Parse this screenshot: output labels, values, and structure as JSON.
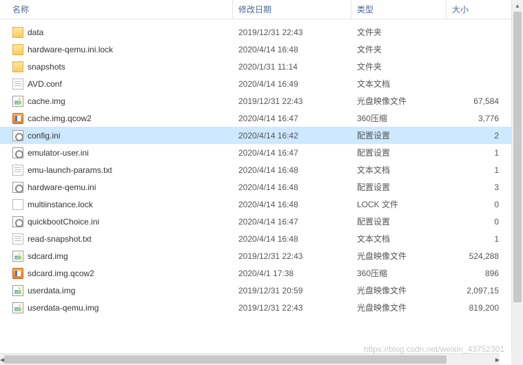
{
  "columns": {
    "name": "名称",
    "date": "修改日期",
    "type": "类型",
    "size": "大小"
  },
  "files": [
    {
      "icon": "folder",
      "name": "data",
      "date": "2019/12/31 22:43",
      "type": "文件夹",
      "size": "",
      "selected": false
    },
    {
      "icon": "folder",
      "name": "hardware-qemu.ini.lock",
      "date": "2020/4/14 16:48",
      "type": "文件夹",
      "size": "",
      "selected": false
    },
    {
      "icon": "folder",
      "name": "snapshots",
      "date": "2020/1/31 11:14",
      "type": "文件夹",
      "size": "",
      "selected": false
    },
    {
      "icon": "txt",
      "name": "AVD.conf",
      "date": "2020/4/14 16:49",
      "type": "文本文档",
      "size": "",
      "selected": false
    },
    {
      "icon": "img",
      "name": "cache.img",
      "date": "2019/12/31 22:43",
      "type": "光盘映像文件",
      "size": "67,584",
      "selected": false
    },
    {
      "icon": "qcow",
      "name": "cache.img.qcow2",
      "date": "2020/4/14 16:47",
      "type": "360压缩",
      "size": "3,776",
      "selected": false
    },
    {
      "icon": "ini",
      "name": "config.ini",
      "date": "2020/4/14 16:42",
      "type": "配置设置",
      "size": "2",
      "selected": true
    },
    {
      "icon": "ini",
      "name": "emulator-user.ini",
      "date": "2020/4/14 16:47",
      "type": "配置设置",
      "size": "1",
      "selected": false
    },
    {
      "icon": "txt",
      "name": "emu-launch-params.txt",
      "date": "2020/4/14 16:48",
      "type": "文本文档",
      "size": "1",
      "selected": false
    },
    {
      "icon": "ini",
      "name": "hardware-qemu.ini",
      "date": "2020/4/14 16:48",
      "type": "配置设置",
      "size": "3",
      "selected": false
    },
    {
      "icon": "lock",
      "name": "multiinstance.lock",
      "date": "2020/4/14 16:48",
      "type": "LOCK 文件",
      "size": "0",
      "selected": false
    },
    {
      "icon": "ini",
      "name": "quickbootChoice.ini",
      "date": "2020/4/14 16:47",
      "type": "配置设置",
      "size": "0",
      "selected": false
    },
    {
      "icon": "txt",
      "name": "read-snapshot.txt",
      "date": "2020/4/14 16:48",
      "type": "文本文档",
      "size": "1",
      "selected": false
    },
    {
      "icon": "img",
      "name": "sdcard.img",
      "date": "2019/12/31 22:43",
      "type": "光盘映像文件",
      "size": "524,288",
      "selected": false
    },
    {
      "icon": "qcow",
      "name": "sdcard.img.qcow2",
      "date": "2020/4/1 17:38",
      "type": "360压缩",
      "size": "896",
      "selected": false
    },
    {
      "icon": "img",
      "name": "userdata.img",
      "date": "2019/12/31 20:59",
      "type": "光盘映像文件",
      "size": "2,097,15",
      "selected": false
    },
    {
      "icon": "img",
      "name": "userdata-qemu.img",
      "date": "2019/12/31 22:43",
      "type": "光盘映像文件",
      "size": "819,200",
      "selected": false
    }
  ],
  "watermark": "https://blog.csdn.net/weixin_43752301"
}
